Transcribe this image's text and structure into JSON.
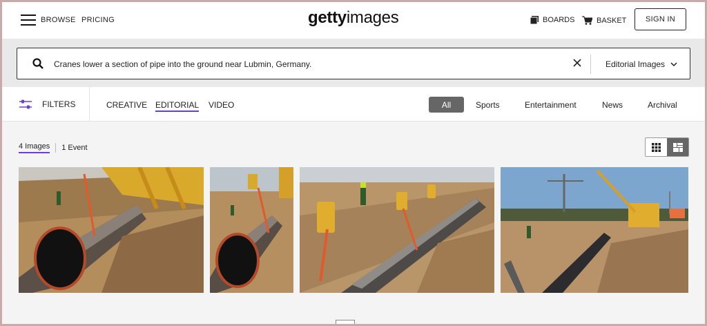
{
  "nav": {
    "browse": "BROWSE",
    "pricing": "PRICING",
    "logo_bold": "getty",
    "logo_light": "images",
    "boards": "BOARDS",
    "basket": "BASKET",
    "sign_in": "SIGN IN"
  },
  "search": {
    "query": "Cranes lower a section of pipe into the ground near Lubmin, Germany.",
    "type_selected": "Editorial Images"
  },
  "filters": {
    "label": "FILTERS",
    "media_tabs": [
      "CREATIVE",
      "EDITORIAL",
      "VIDEO"
    ],
    "active_media_tab": "EDITORIAL",
    "categories": [
      "All",
      "Sports",
      "Entertainment",
      "News",
      "Archival"
    ],
    "active_category": "All"
  },
  "results": {
    "images_count": "4 Images",
    "events_count": "1 Event",
    "active_view": "mosaic"
  },
  "colors": {
    "accent": "#6b3fd6",
    "pill": "#666666",
    "pipe_strap": "#e05a2b",
    "crane_yellow": "#e9b32a"
  },
  "icons": [
    "menu-icon",
    "boards-icon",
    "basket-icon",
    "search-icon",
    "close-icon",
    "chevron-down-icon",
    "filters-icon",
    "grid-view-icon",
    "mosaic-view-icon"
  ]
}
